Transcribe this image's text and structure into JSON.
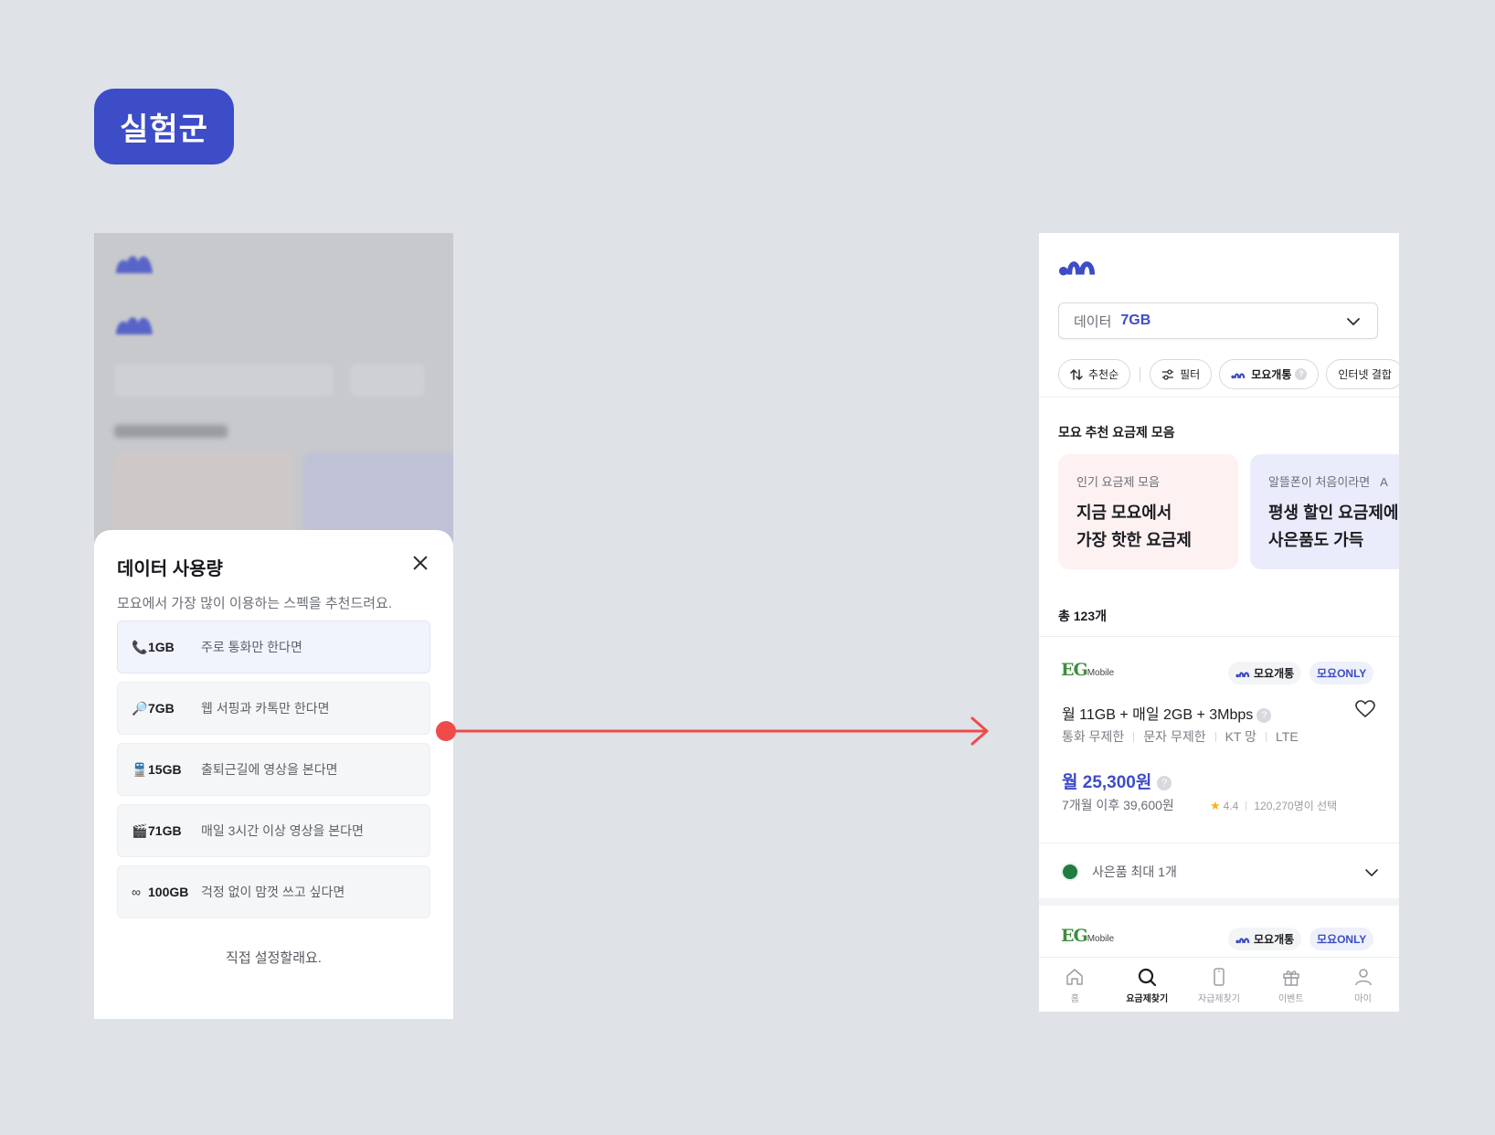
{
  "badge_label": "실험군",
  "left_screen": {
    "sheet": {
      "title": "데이터 사용량",
      "subtitle": "모요에서 가장 많이 이용하는 스펙을 추천드려요.",
      "options": [
        {
          "icon": "phone-icon",
          "glyph": "📞",
          "size": "1GB",
          "desc": "주로 통화만 한다면",
          "selected": true
        },
        {
          "icon": "magnifier-icon",
          "glyph": "🔎",
          "size": "7GB",
          "desc": "웹 서핑과 카톡만 한다면",
          "selected": false
        },
        {
          "icon": "train-icon",
          "glyph": "🚆",
          "size": "15GB",
          "desc": "출퇴근길에 영상을 본다면",
          "selected": false
        },
        {
          "icon": "clapper-icon",
          "glyph": "🎬",
          "size": "71GB",
          "desc": "매일 3시간 이상 영상을 본다면",
          "selected": false
        },
        {
          "icon": "infinity-icon",
          "glyph": "∞",
          "size": "100GB",
          "desc": "걱정 없이 맘껏 쓰고 싶다면",
          "selected": false
        }
      ],
      "direct_label": "직접 설정할래요."
    }
  },
  "right_screen": {
    "dropdown": {
      "label": "데이터",
      "value": "7GB"
    },
    "chips": {
      "sort": "추천순",
      "filter": "필터",
      "moyo_open": "모요개통",
      "internet": "인터넷 결합"
    },
    "section_title": "모요 추천 요금제 모음",
    "rec_cards": [
      {
        "small": "인기 요금제 모음",
        "big": "지금 모요에서\n가장 핫한 요금제",
        "bg": "#fdf1f1"
      },
      {
        "small": "알뜰폰이 처음이라면   A",
        "big": "평생 할인 요금제에\n사은품도 가득",
        "bg": "#eaecfb"
      }
    ],
    "total": "총 123개",
    "plans": [
      {
        "carrier": "EG",
        "carrier_sub": "Mobile",
        "tag_open": "모요개통",
        "tag_only": "모요ONLY",
        "name": "월 11GB + 매일 2GB + 3Mbps",
        "meta": [
          "통화 무제한",
          "문자 무제한",
          "KT 망",
          "LTE"
        ],
        "price": "월 25,300원",
        "after": "7개월 이후 39,600원",
        "rating": "4.4",
        "selected_count": "120,270명이 선택",
        "gift": "사은품 최대 1개"
      },
      {
        "carrier": "EG",
        "carrier_sub": "Mobile",
        "tag_open": "모요개통",
        "tag_only": "모요ONLY"
      }
    ],
    "tabbar": [
      {
        "icon": "home-icon",
        "label": "홈",
        "active": false
      },
      {
        "icon": "search-icon",
        "label": "요금제찾기",
        "active": true
      },
      {
        "icon": "phone-device-icon",
        "label": "자급제찾기",
        "active": false
      },
      {
        "icon": "gift-icon",
        "label": "이벤트",
        "active": false
      },
      {
        "icon": "person-icon",
        "label": "마이",
        "active": false
      }
    ]
  },
  "colors": {
    "brand": "#3d4cc7",
    "arrow": "#f04b4b",
    "background": "#dfe2e7"
  }
}
